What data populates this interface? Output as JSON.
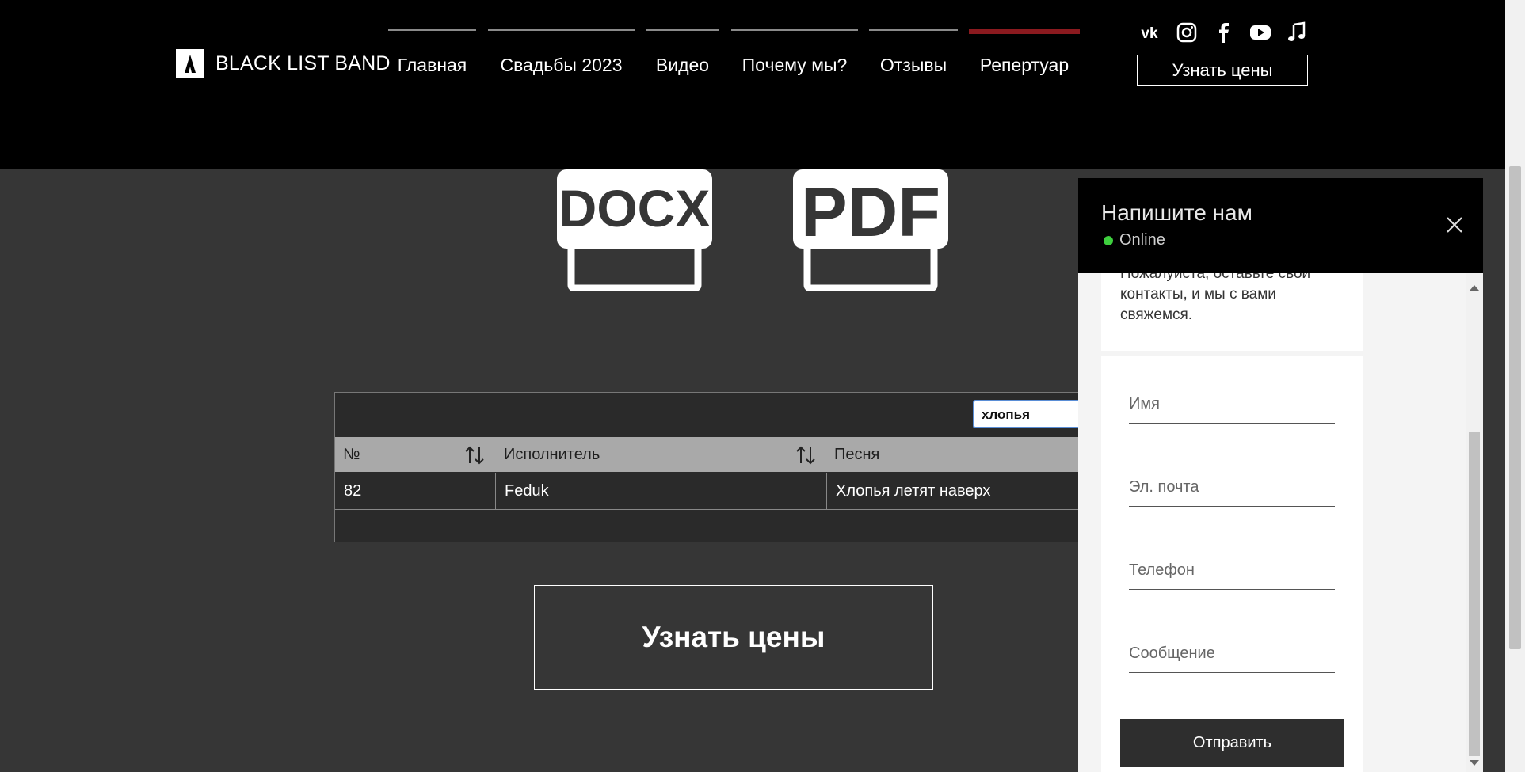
{
  "header": {
    "logo_text": "BLACK LIST BAND",
    "nav": [
      {
        "label": "Главная"
      },
      {
        "label": "Свадьбы 2023"
      },
      {
        "label": "Видео"
      },
      {
        "label": "Почему мы?"
      },
      {
        "label": "Отзывы"
      },
      {
        "label": "Репертуар",
        "active": true
      }
    ],
    "social_icons": [
      "vk-icon",
      "instagram-icon",
      "facebook-icon",
      "youtube-icon",
      "music-icon"
    ],
    "cta_label": "Узнать цены",
    "active_color": "#8b1a1f"
  },
  "downloads": {
    "docx_label": "DOCX",
    "pdf_label": "PDF"
  },
  "table": {
    "search_value": "хлопья",
    "columns": [
      "№",
      "Исполнитель",
      "Песня"
    ],
    "rows": [
      {
        "num": "82",
        "artist": "Feduk",
        "song": "Хлопья летят наверх"
      }
    ]
  },
  "main_cta_label": "Узнать цены",
  "chat": {
    "title": "Напишите нам",
    "status": "Online",
    "intro": "Пожалуйста, оставьте свои контакты, и мы с вами свяжемся.",
    "fields": {
      "name": "Имя",
      "email": "Эл. почта",
      "phone": "Телефон",
      "message": "Сообщение"
    },
    "submit_label": "Отправить",
    "status_color": "#3ecf3e"
  }
}
